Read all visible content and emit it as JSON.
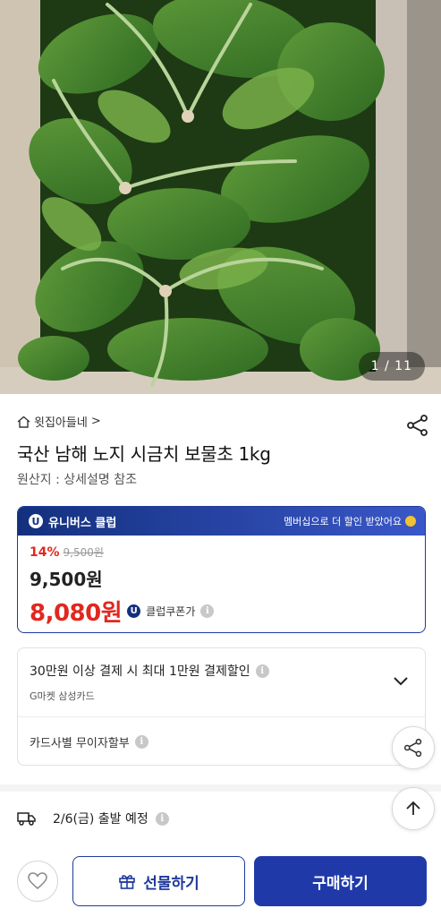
{
  "product_image": {
    "counter": "1 / 11"
  },
  "seller": {
    "name": "윗집아들네",
    "arrow": ">"
  },
  "product": {
    "title": "국산 남해 노지 시금치 보물초 1kg",
    "origin": "원산지 : 상세설명 참조"
  },
  "club": {
    "badge": "U",
    "name": "유니버스 클럽",
    "promo": "멤버십으로 더 할인 받았어요",
    "discount_rate": "14%",
    "original_price": "9,500원",
    "price": "9,500원",
    "club_price": "8,080원",
    "club_price_label": "클럽쿠폰가"
  },
  "card_discount": {
    "text": "30만원 이상 결제 시 최대 1만원 결제할인",
    "card_name": "G마켓 삼성카드",
    "installment": "카드사별 무이자할부"
  },
  "delivery": {
    "date": "2/6(금) 출발 예정"
  },
  "bottom_bar": {
    "gift_label": "선물하기",
    "buy_label": "구매하기"
  },
  "colors": {
    "brand_blue": "#1f3aa8",
    "discount_red": "#e0281f"
  },
  "icons": [
    "home-icon",
    "share-icon",
    "info-icon",
    "chevron-down-icon",
    "arrow-up-icon",
    "truck-icon",
    "heart-icon",
    "gift-icon"
  ]
}
